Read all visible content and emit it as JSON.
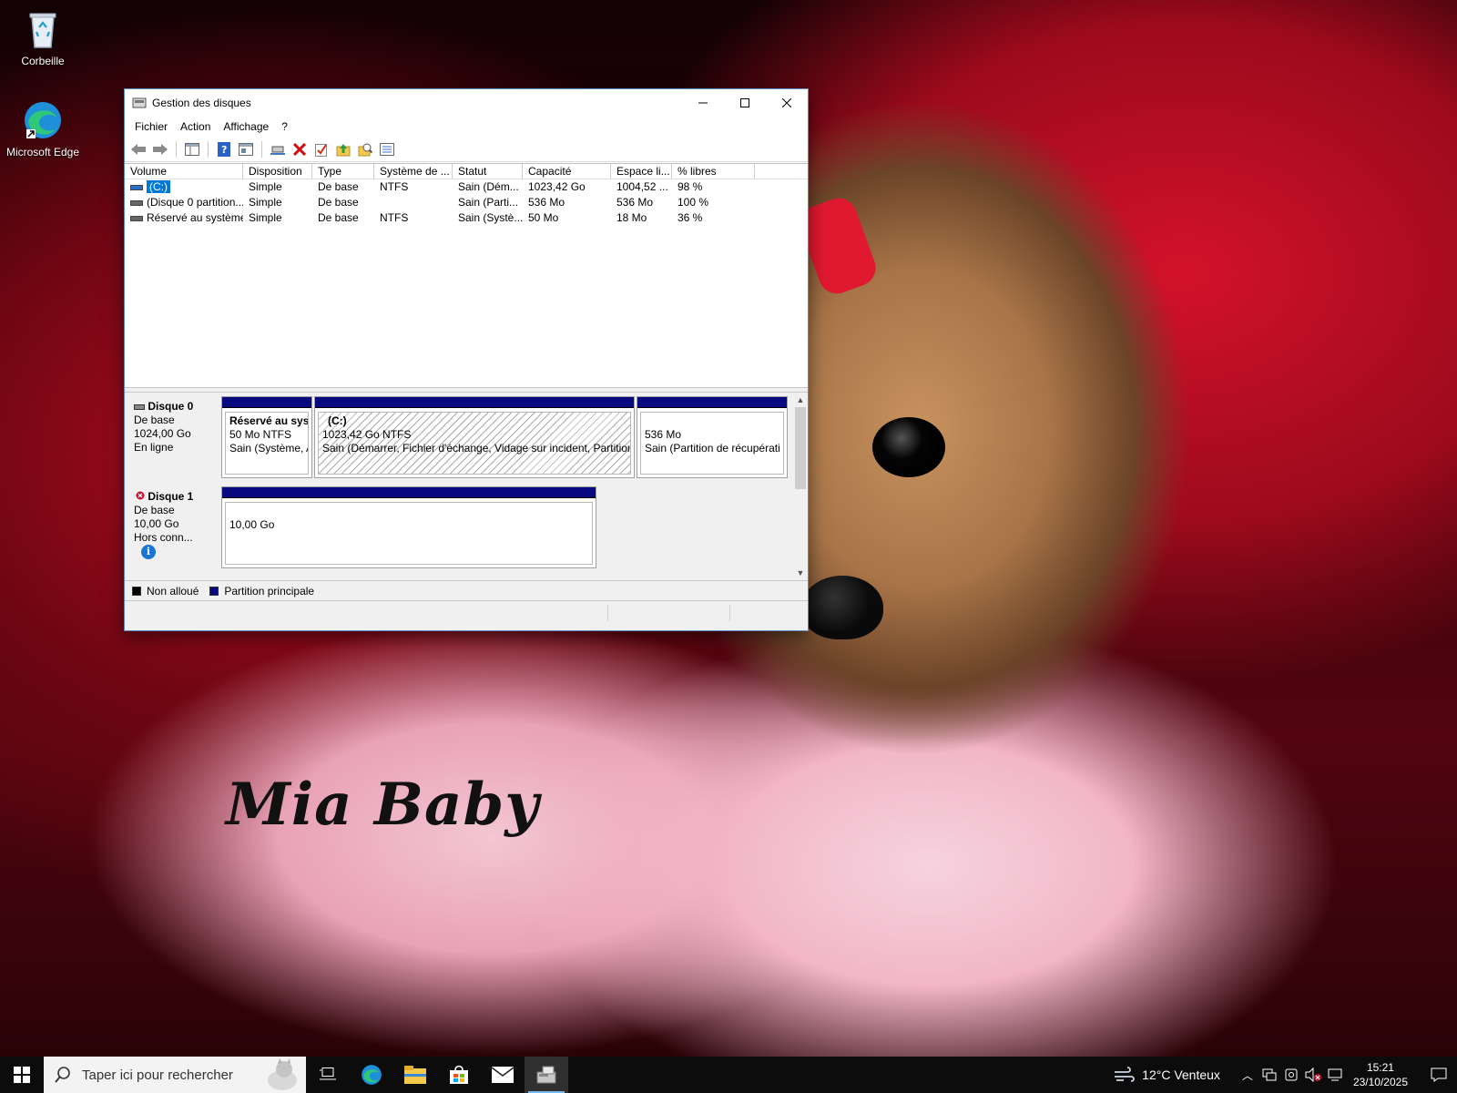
{
  "desktop": {
    "icons": [
      {
        "label": "Corbeille",
        "icon": "recycle-bin-icon"
      },
      {
        "label": "Microsoft Edge",
        "icon": "edge-icon"
      }
    ],
    "wallpaper_text": "Mia Baby"
  },
  "window": {
    "title": "Gestion des disques",
    "menu": [
      "Fichier",
      "Action",
      "Affichage",
      "?"
    ],
    "toolbar_icons": [
      "back-icon",
      "forward-icon",
      "console-tree-icon",
      "help-icon",
      "properties-icon",
      "connect-icon",
      "delete-icon",
      "check-icon",
      "up-folder-icon",
      "search-folder-icon",
      "list-icon"
    ],
    "columns": [
      "Volume",
      "Disposition",
      "Type",
      "Système de ...",
      "Statut",
      "Capacité",
      "Espace li...",
      "% libres"
    ],
    "rows": [
      {
        "volume": "(C:)",
        "disposition": "Simple",
        "type": "De base",
        "fs": "NTFS",
        "statut": "Sain (Dém...",
        "capacite": "1023,42 Go",
        "espace": "1004,52 ...",
        "libres": "98 %",
        "selected": true
      },
      {
        "volume": "(Disque 0 partition...",
        "disposition": "Simple",
        "type": "De base",
        "fs": "",
        "statut": "Sain (Parti...",
        "capacite": "536 Mo",
        "espace": "536 Mo",
        "libres": "100 %",
        "selected": false
      },
      {
        "volume": "Réservé au système",
        "disposition": "Simple",
        "type": "De base",
        "fs": "NTFS",
        "statut": "Sain (Systè...",
        "capacite": "50 Mo",
        "espace": "18 Mo",
        "libres": "36 %",
        "selected": false
      }
    ],
    "disks": [
      {
        "name": "Disque 0",
        "type": "De base",
        "size": "1024,00 Go",
        "status": "En ligne",
        "partitions": [
          {
            "title": "Réservé au syst",
            "line2": "50 Mo NTFS",
            "line3": "Sain (Système, A"
          },
          {
            "title": "(C:)",
            "line2": "1023,42 Go NTFS",
            "line3": "Sain (Démarrer, Fichier d'échange, Vidage sur incident, Partition p"
          },
          {
            "title": "",
            "line2": "536 Mo",
            "line3": "Sain (Partition de récupérati"
          }
        ]
      },
      {
        "name": "Disque 1",
        "type": "De base",
        "size": "10,00 Go",
        "status": "Hors conn...",
        "partitions": [
          {
            "title": "",
            "line2": "10,00 Go",
            "line3": ""
          }
        ]
      }
    ],
    "legend": [
      {
        "label": "Non alloué",
        "color": "#000000"
      },
      {
        "label": "Partition principale",
        "color": "#0a0a80"
      }
    ]
  },
  "taskbar": {
    "search_placeholder": "Taper ici pour rechercher",
    "apps": [
      "task-view-icon",
      "edge-icon",
      "file-explorer-icon",
      "store-icon",
      "mail-icon",
      "disk-management-icon"
    ],
    "weather": "12°C  Venteux",
    "time": "15:21",
    "date": "23/10/2025"
  },
  "colors": {
    "accent": "#0078d7",
    "partition_bar": "#0a0a80"
  }
}
